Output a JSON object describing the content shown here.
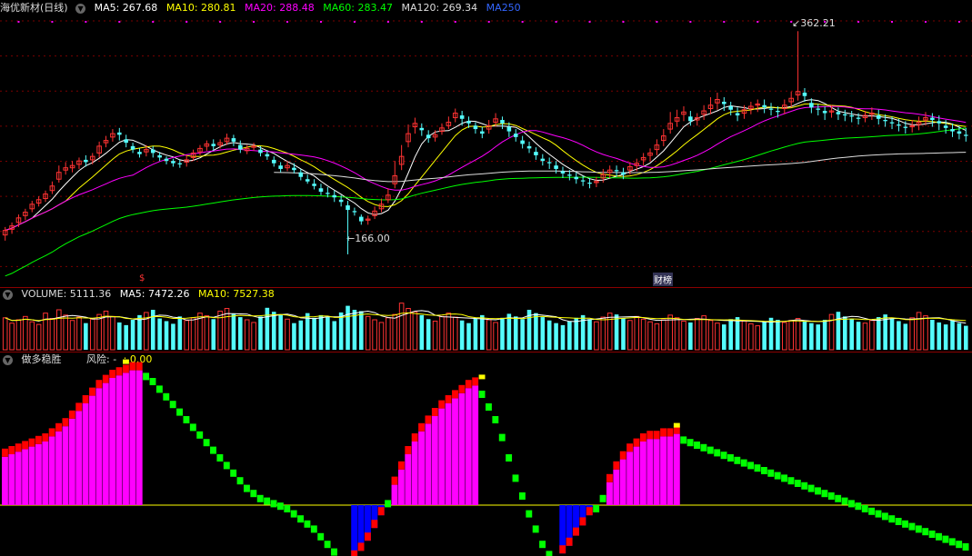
{
  "price_header": {
    "title": "海优新材(日线)",
    "ma5": "MA5: 267.68",
    "ma10": "MA10: 280.81",
    "ma20": "MA20: 288.48",
    "ma60": "MA60: 283.47",
    "ma120": "MA120: 269.34",
    "ma250": "MA250"
  },
  "volume_header": {
    "title": "VOLUME: 5111.36",
    "ma5": "MA5: 7472.26",
    "ma10": "MA10: 7527.38"
  },
  "indicator_header": {
    "title": "做多稳胜",
    "risk_label": "风险: -",
    "risk_value": ": 0.00"
  },
  "annotations": {
    "max_label": "362.21",
    "min_label": "166.00",
    "signal_1": "$",
    "signal_2": "财榜"
  },
  "colors": {
    "up": "#ff3333",
    "down": "#54fcfc",
    "ma5": "#ffffff",
    "ma10": "#ffff00",
    "ma20": "#ff00ff",
    "ma60": "#00ff00",
    "ma120": "#dddddd",
    "ma250": "#0000ff",
    "ind_magenta": "#ff00ff",
    "ind_red": "#ff0000",
    "ind_green": "#00ff00",
    "ind_blue": "#0000ff",
    "ind_yellow": "#ffff00"
  },
  "chart_data": [
    {
      "type": "candlestick",
      "title": "海优新材(日线)",
      "ylim": [
        150,
        375
      ],
      "close": [
        187,
        191,
        198,
        203,
        210,
        214,
        219,
        226,
        238,
        242,
        244,
        248,
        247,
        252,
        261,
        266,
        272,
        271,
        264,
        258,
        254,
        258,
        255,
        251,
        248,
        246,
        245,
        249,
        255,
        259,
        263,
        261,
        264,
        268,
        265,
        258,
        259,
        261,
        255,
        252,
        246,
        241,
        244,
        240,
        234,
        230,
        226,
        221,
        219,
        216,
        212,
        205,
        203,
        195,
        197,
        204,
        210,
        218,
        235,
        252,
        272,
        281,
        275,
        268,
        271,
        277,
        282,
        290,
        285,
        281,
        276,
        272,
        279,
        285,
        281,
        274,
        269,
        263,
        259,
        253,
        248,
        246,
        241,
        237,
        235,
        232,
        230,
        228,
        230,
        236,
        240,
        239,
        236,
        243,
        246,
        251,
        255,
        262,
        270,
        281,
        286,
        291,
        283,
        286,
        292,
        297,
        302,
        298,
        293,
        288,
        293,
        296,
        298,
        295,
        293,
        291,
        297,
        303,
        309,
        305,
        295,
        293,
        290,
        292,
        289,
        288,
        287,
        285,
        288,
        290,
        285,
        283,
        281,
        279,
        277,
        279,
        282,
        286,
        284,
        281,
        277,
        274,
        272,
        270
      ],
      "open": [
        183,
        188,
        194,
        200,
        206,
        211,
        215,
        222,
        232,
        240,
        242,
        245,
        249,
        249,
        255,
        264,
        269,
        273,
        267,
        261,
        256,
        256,
        258,
        253,
        250,
        248,
        246,
        247,
        251,
        256,
        261,
        263,
        262,
        265,
        268,
        262,
        257,
        260,
        258,
        254,
        249,
        244,
        242,
        242,
        238,
        232,
        228,
        224,
        220,
        218,
        214,
        209,
        204,
        199,
        196,
        200,
        206,
        214,
        228,
        245,
        265,
        278,
        277,
        271,
        269,
        274,
        279,
        286,
        288,
        283,
        279,
        274,
        276,
        282,
        284,
        278,
        272,
        266,
        261,
        256,
        250,
        247,
        244,
        239,
        236,
        234,
        231,
        229,
        229,
        233,
        238,
        240,
        238,
        240,
        244,
        249,
        253,
        258,
        266,
        276,
        283,
        289,
        287,
        284,
        289,
        294,
        299,
        300,
        296,
        290,
        290,
        294,
        297,
        297,
        294,
        292,
        294,
        300,
        306,
        308,
        299,
        294,
        292,
        291,
        291,
        289,
        288,
        286,
        286,
        289,
        288,
        284,
        282,
        280,
        278,
        278,
        280,
        284,
        286,
        283,
        279,
        276,
        274,
        271
      ],
      "high": [
        190,
        194,
        201,
        206,
        213,
        217,
        222,
        230,
        244,
        247,
        248,
        251,
        253,
        255,
        265,
        270,
        276,
        277,
        271,
        264,
        259,
        262,
        261,
        256,
        252,
        250,
        249,
        253,
        258,
        262,
        266,
        267,
        267,
        272,
        271,
        266,
        262,
        264,
        261,
        257,
        252,
        247,
        248,
        246,
        241,
        236,
        232,
        228,
        225,
        222,
        218,
        213,
        207,
        201,
        200,
        208,
        215,
        224,
        248,
        262,
        280,
        286,
        281,
        275,
        275,
        281,
        287,
        294,
        292,
        287,
        282,
        278,
        284,
        290,
        287,
        282,
        276,
        270,
        265,
        260,
        254,
        251,
        248,
        243,
        240,
        238,
        235,
        233,
        234,
        241,
        244,
        244,
        242,
        247,
        250,
        255,
        259,
        267,
        276,
        291,
        293,
        296,
        292,
        290,
        297,
        304,
        308,
        304,
        300,
        295,
        297,
        300,
        302,
        302,
        299,
        296,
        302,
        309,
        362,
        312,
        303,
        298,
        296,
        297,
        295,
        293,
        292,
        290,
        292,
        295,
        293,
        289,
        287,
        285,
        283,
        284,
        287,
        291,
        290,
        288,
        284,
        281,
        279,
        277
      ],
      "low": [
        178,
        184,
        190,
        196,
        203,
        208,
        212,
        219,
        229,
        236,
        238,
        241,
        243,
        245,
        251,
        260,
        265,
        266,
        260,
        255,
        251,
        252,
        251,
        248,
        245,
        243,
        242,
        243,
        248,
        253,
        257,
        257,
        259,
        262,
        261,
        255,
        254,
        257,
        252,
        249,
        243,
        238,
        239,
        237,
        231,
        228,
        223,
        218,
        216,
        212,
        208,
        166,
        200,
        192,
        192,
        197,
        203,
        211,
        224,
        240,
        260,
        272,
        270,
        264,
        265,
        271,
        276,
        282,
        279,
        277,
        272,
        268,
        272,
        278,
        276,
        269,
        265,
        259,
        255,
        249,
        244,
        241,
        237,
        233,
        231,
        228,
        226,
        224,
        225,
        229,
        233,
        234,
        232,
        236,
        239,
        244,
        248,
        253,
        261,
        272,
        278,
        283,
        279,
        279,
        284,
        289,
        293,
        292,
        288,
        283,
        285,
        289,
        291,
        290,
        288,
        286,
        289,
        295,
        301,
        300,
        290,
        288,
        284,
        286,
        284,
        283,
        282,
        280,
        282,
        284,
        280,
        278,
        276,
        274,
        272,
        273,
        275,
        279,
        278,
        275,
        272,
        269,
        267,
        265
      ]
    },
    {
      "type": "bar",
      "title": "VOLUME: 5111.36",
      "values": [
        48,
        40,
        45,
        50,
        42,
        38,
        55,
        47,
        60,
        52,
        44,
        49,
        40,
        46,
        53,
        58,
        50,
        41,
        37,
        45,
        52,
        56,
        60,
        47,
        43,
        39,
        50,
        44,
        48,
        55,
        51,
        46,
        58,
        62,
        54,
        49,
        45,
        41,
        50,
        63,
        57,
        52,
        46,
        40,
        44,
        55,
        48,
        52,
        49,
        43,
        56,
        66,
        60,
        58,
        50,
        45,
        41,
        48,
        53,
        70,
        62,
        57,
        52,
        46,
        43,
        50,
        55,
        49,
        44,
        40,
        47,
        52,
        45,
        41,
        48,
        54,
        50,
        46,
        60,
        55,
        49,
        44,
        40,
        37,
        43,
        48,
        52,
        46,
        42,
        49,
        55,
        53,
        47,
        44,
        50,
        46,
        42,
        39,
        45,
        52,
        48,
        43,
        41,
        47,
        51,
        44,
        40,
        38,
        46,
        49,
        43,
        39,
        36,
        42,
        48,
        45,
        41,
        44,
        47,
        43,
        40,
        38,
        45,
        53,
        57,
        50,
        46,
        42,
        40,
        44,
        49,
        53,
        47,
        43,
        39,
        48,
        56,
        51,
        45,
        41,
        38,
        44,
        40,
        36
      ]
    },
    {
      "type": "bar",
      "title": "做多稳胜",
      "values": [
        38,
        40,
        42,
        44,
        46,
        48,
        50,
        54,
        58,
        62,
        68,
        74,
        80,
        86,
        92,
        96,
        100,
        102,
        104,
        106,
        106,
        104,
        100,
        94,
        88,
        82,
        76,
        70,
        64,
        58,
        52,
        46,
        40,
        34,
        28,
        22,
        16,
        12,
        8,
        6,
        4,
        2,
        0,
        -4,
        -8,
        -12,
        -16,
        -22,
        -28,
        -34,
        -40,
        -44,
        -42,
        -36,
        -28,
        -18,
        -8,
        4,
        16,
        28,
        40,
        50,
        58,
        64,
        70,
        76,
        80,
        84,
        88,
        92,
        94,
        90,
        80,
        70,
        56,
        40,
        24,
        10,
        -4,
        -16,
        -28,
        -36,
        -40,
        -38,
        -32,
        -24,
        -16,
        -8,
        0,
        8,
        18,
        28,
        36,
        42,
        46,
        50,
        52,
        52,
        54,
        54,
        56,
        54,
        52,
        50,
        48,
        46,
        44,
        42,
        40,
        38,
        36,
        34,
        32,
        30,
        28,
        26,
        24,
        22,
        20,
        18,
        16,
        14,
        12,
        10,
        8,
        6,
        4,
        2,
        0,
        -2,
        -4,
        -6,
        -8,
        -10,
        -12,
        -14,
        -16,
        -18,
        -20,
        -22,
        -24,
        -26,
        -28,
        -30
      ]
    }
  ]
}
